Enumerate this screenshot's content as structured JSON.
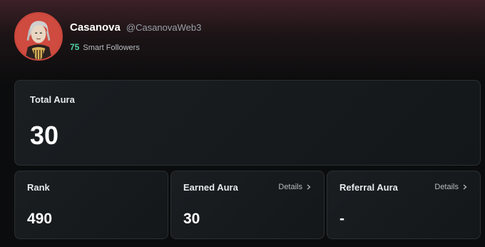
{
  "profile": {
    "name": "Casanova",
    "handle": "@CasanovaWeb3",
    "followers_count": "75",
    "followers_label": "Smart Followers",
    "avatar_icon": "avatar-illustration"
  },
  "total": {
    "label": "Total Aura",
    "value": "30"
  },
  "stats": {
    "rank": {
      "label": "Rank",
      "value": "490"
    },
    "earned": {
      "label": "Earned Aura",
      "value": "30",
      "details_label": "Details"
    },
    "referral": {
      "label": "Referral Aura",
      "value": "-",
      "details_label": "Details"
    }
  },
  "colors": {
    "accent_green": "#4fd1a5",
    "avatar_ring": "#c9463d",
    "background": "#0b0c0d"
  }
}
